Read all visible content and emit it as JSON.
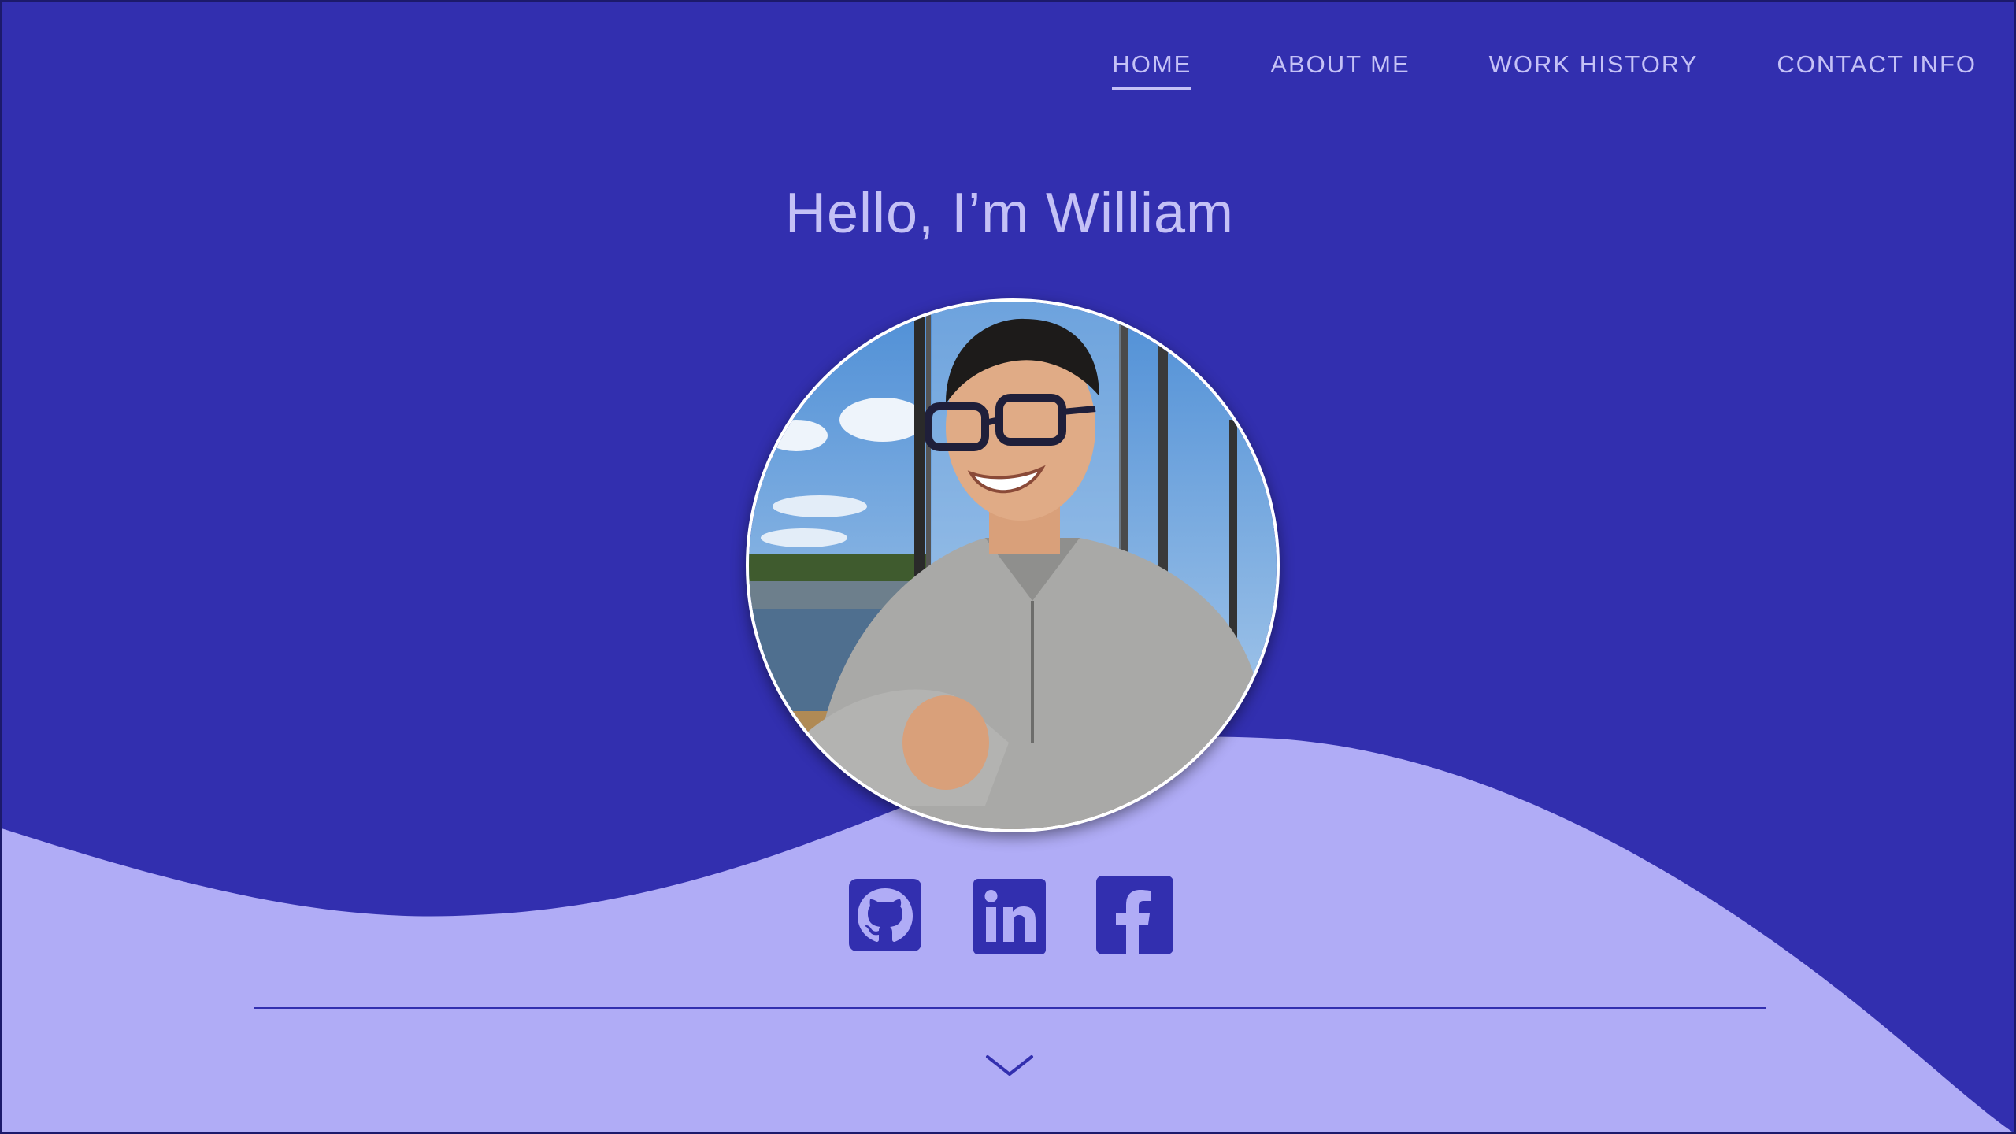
{
  "nav": {
    "items": [
      {
        "label": "HOME",
        "active": true
      },
      {
        "label": "ABOUT ME",
        "active": false
      },
      {
        "label": "WORK HISTORY",
        "active": false
      },
      {
        "label": "CONTACT INFO",
        "active": false
      }
    ]
  },
  "hero": {
    "greeting": "Hello, I’m William",
    "avatar_icon": "profile-photo"
  },
  "social": {
    "links": [
      {
        "icon": "github-icon"
      },
      {
        "icon": "linkedin-icon"
      },
      {
        "icon": "facebook-icon"
      }
    ]
  },
  "scroll": {
    "icon": "chevron-down-icon"
  },
  "colors": {
    "background": "#322faf",
    "wave": "#b0acf6",
    "text": "#c4c1f6"
  }
}
